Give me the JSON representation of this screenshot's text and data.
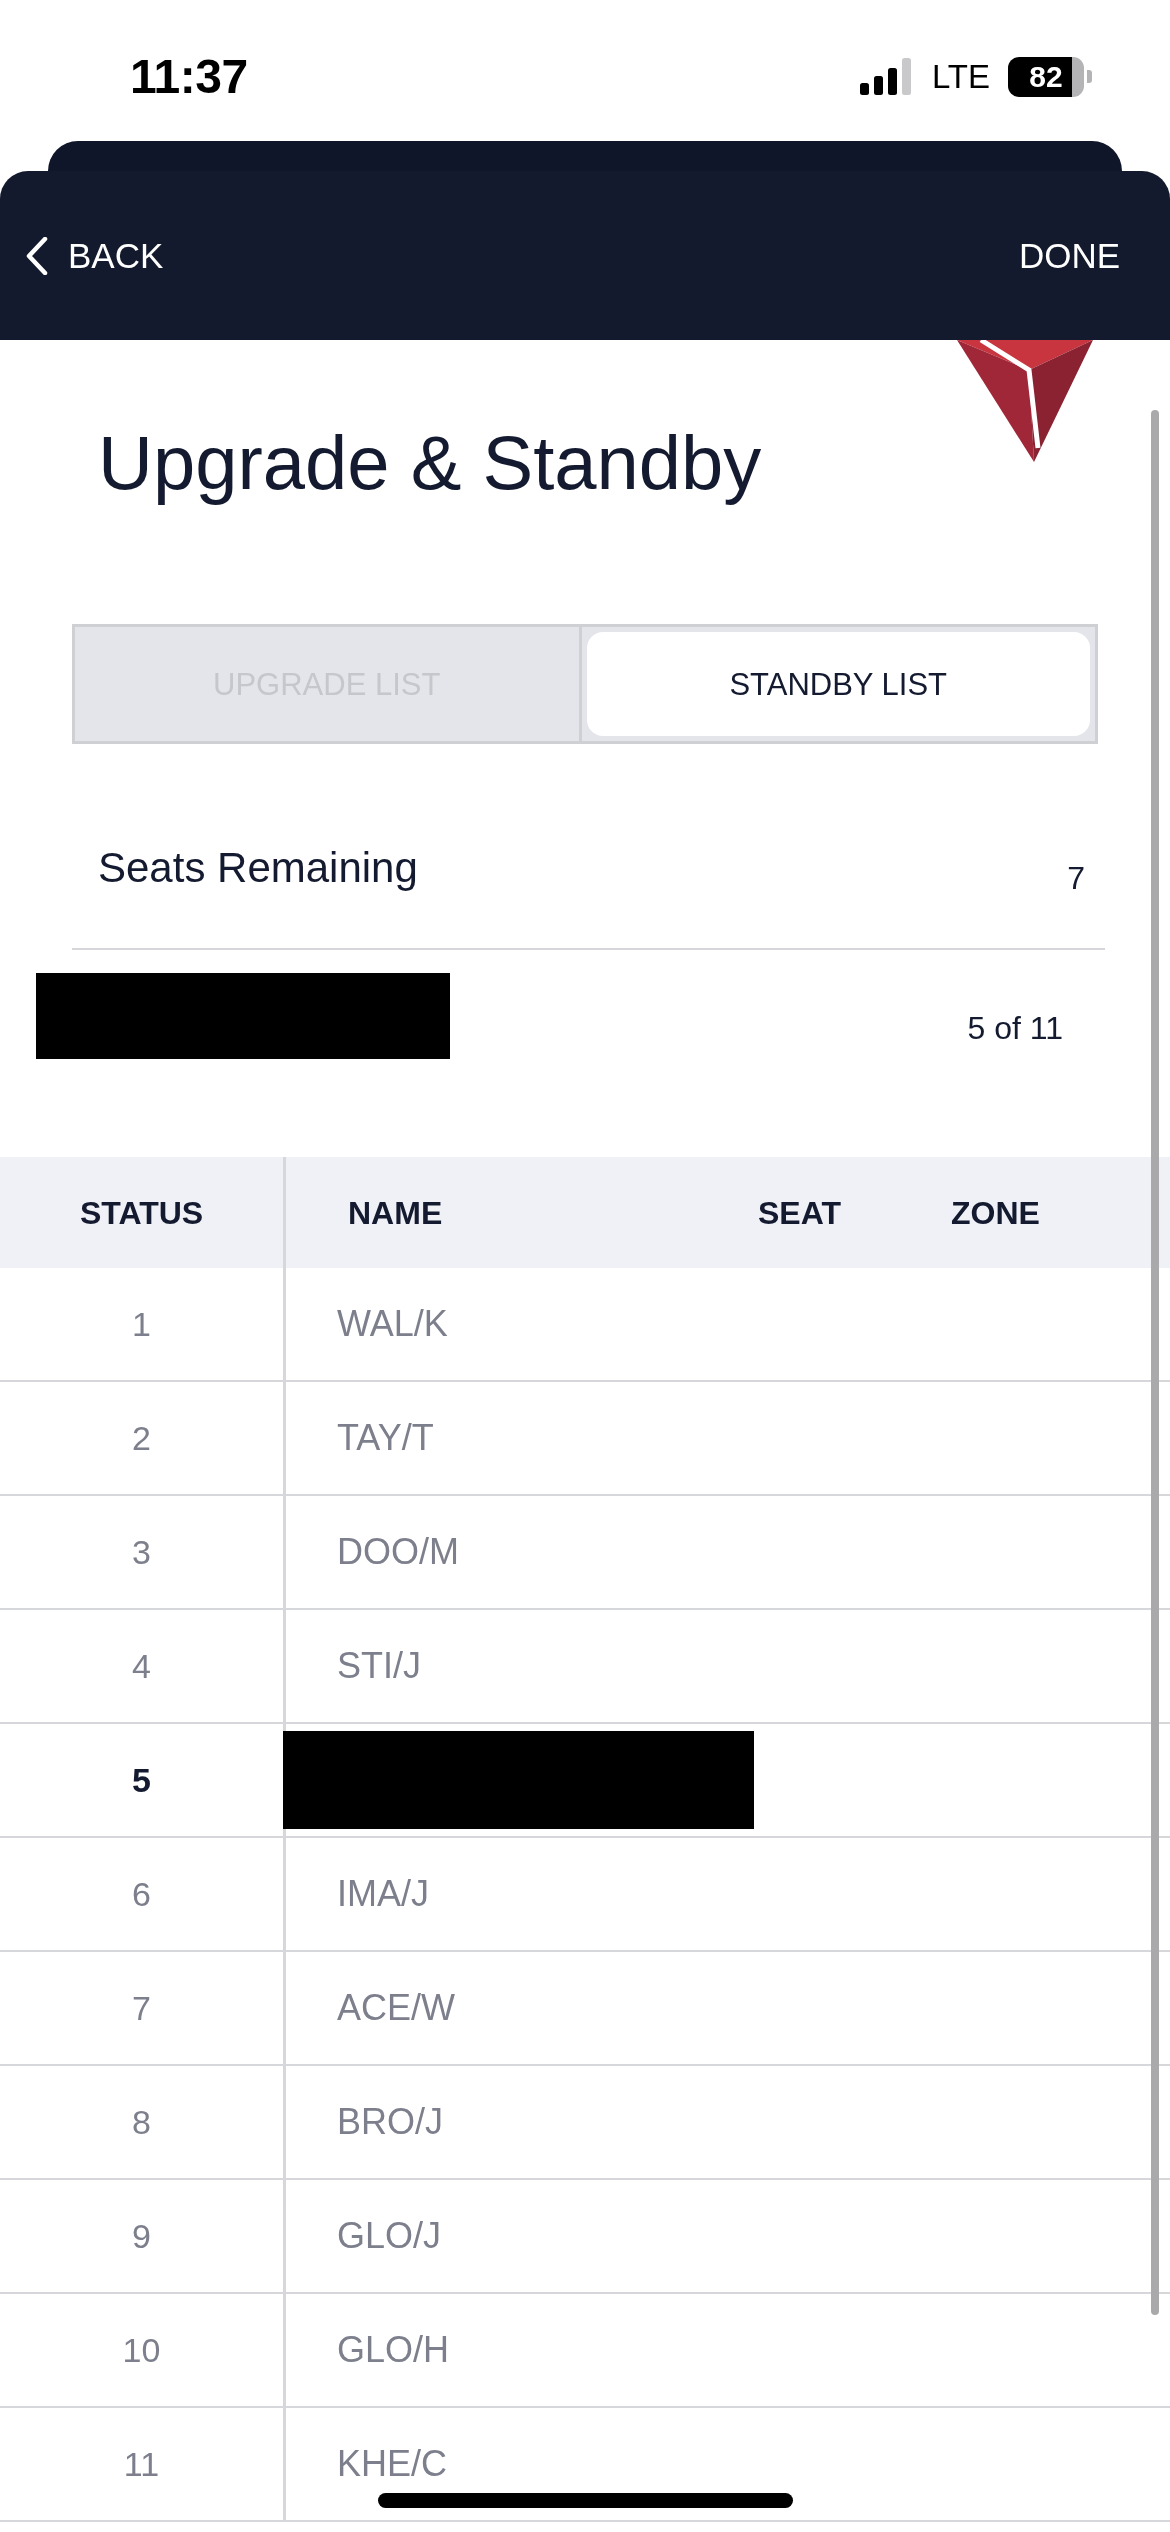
{
  "status_bar": {
    "time": "11:37",
    "network": "LTE",
    "battery": "82"
  },
  "nav_bar": {
    "back": "BACK",
    "done": "DONE"
  },
  "title": "Upgrade & Standby",
  "tabs": [
    {
      "label": "UPGRADE LIST",
      "selected": false
    },
    {
      "label": "STANDBY LIST",
      "selected": true
    }
  ],
  "seats_remaining": {
    "label": "Seats Remaining",
    "value": "7"
  },
  "position": {
    "label_redacted": true,
    "value": "5 of 11"
  },
  "table": {
    "columns": [
      "STATUS",
      "NAME",
      "SEAT",
      "ZONE"
    ],
    "rows": [
      {
        "status": "1",
        "name": "WAL/K",
        "current": false,
        "redacted": false
      },
      {
        "status": "2",
        "name": "TAY/T",
        "current": false,
        "redacted": false
      },
      {
        "status": "3",
        "name": "DOO/M",
        "current": false,
        "redacted": false
      },
      {
        "status": "4",
        "name": "STI/J",
        "current": false,
        "redacted": false
      },
      {
        "status": "5",
        "current": true,
        "redacted": true
      },
      {
        "status": "6",
        "name": "IMA/J",
        "current": false,
        "redacted": false
      },
      {
        "status": "7",
        "name": "ACE/W",
        "current": false,
        "redacted": false
      },
      {
        "status": "8",
        "name": "BRO/J",
        "current": false,
        "redacted": false
      },
      {
        "status": "9",
        "name": "GLO/J",
        "current": false,
        "redacted": false
      },
      {
        "status": "10",
        "name": "GLO/H",
        "current": false,
        "redacted": false
      },
      {
        "status": "11",
        "name": "KHE/C",
        "current": false,
        "redacted": false
      }
    ]
  }
}
